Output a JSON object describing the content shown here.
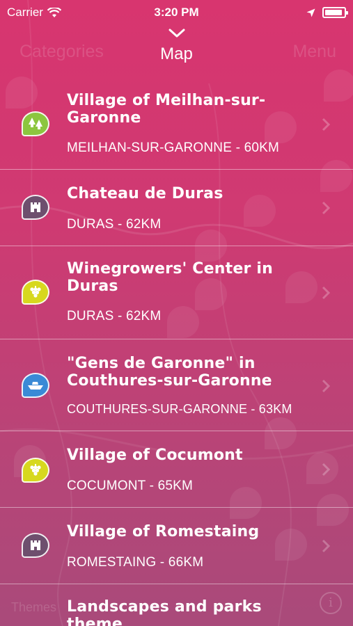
{
  "status_bar": {
    "carrier": "Carrier",
    "time": "3:20 PM"
  },
  "nav": {
    "left_label": "Categories",
    "title": "Map",
    "right_label": "Menu"
  },
  "colors": {
    "nature": "#8cc63f",
    "heritage": "#6e4f6e",
    "wine": "#d7d81e",
    "boat": "#3a8ad6"
  },
  "items": [
    {
      "title": "Village of Meilhan-sur-Garonne",
      "subtitle": "MEILHAN-SUR-GARONNE - 60KM",
      "icon": "trees-icon",
      "category": "nature"
    },
    {
      "title": "Chateau de Duras",
      "subtitle": "DURAS - 62KM",
      "icon": "castle-icon",
      "category": "heritage"
    },
    {
      "title": "Winegrowers' Center in Duras",
      "subtitle": "DURAS - 62KM",
      "icon": "grapes-icon",
      "category": "wine"
    },
    {
      "title": "\"Gens de Garonne\" in Couthures-sur-Garonne",
      "subtitle": "COUTHURES-SUR-GARONNE - 63KM",
      "icon": "boat-icon",
      "category": "boat"
    },
    {
      "title": "Village of Cocumont",
      "subtitle": "COCUMONT - 65KM",
      "icon": "grapes-icon",
      "category": "wine"
    },
    {
      "title": "Village of Romestaing",
      "subtitle": "ROMESTAING - 66KM",
      "icon": "castle-icon",
      "category": "heritage"
    },
    {
      "title": "Landscapes and parks theme",
      "subtitle": "",
      "icon": "trees-icon",
      "category": "nature"
    }
  ],
  "bottom_bar": {
    "left_label": "Themes"
  }
}
